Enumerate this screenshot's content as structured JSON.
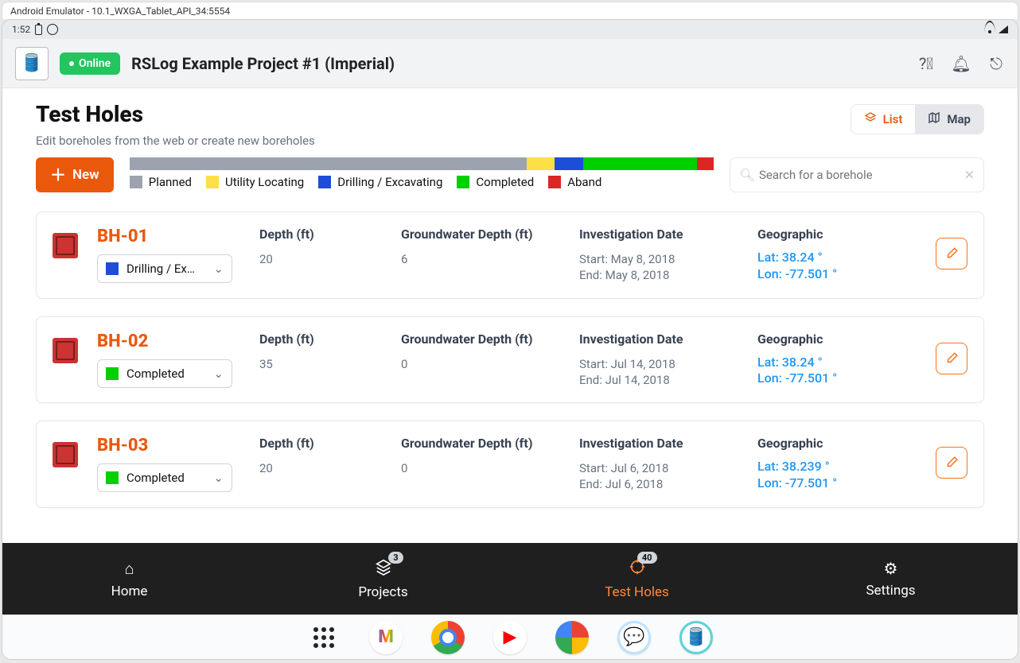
{
  "emulator_title": "Android Emulator - 10.1_WXGA_Tablet_API_34:5554",
  "status": {
    "time": "1:52"
  },
  "header": {
    "online": "Online",
    "project": "RSLog Example Project #1 (Imperial)"
  },
  "page": {
    "title": "Test Holes",
    "subtitle": "Edit boreholes from the web or create new boreholes",
    "new_label": "New",
    "view": {
      "list": "List",
      "map": "Map"
    },
    "search_placeholder": "Search for a borehole"
  },
  "legend": {
    "items": [
      {
        "label": "Planned",
        "color": "#9ca3af",
        "weight": 14
      },
      {
        "label": "Utility Locating",
        "color": "#fde047",
        "weight": 1
      },
      {
        "label": "Drilling / Excavating",
        "color": "#1d4ed8",
        "weight": 1
      },
      {
        "label": "Completed",
        "color": "#00d000",
        "weight": 4
      },
      {
        "label": "Aband",
        "color": "#dc2626",
        "weight": 0.6
      }
    ]
  },
  "columns": {
    "depth": "Depth (ft)",
    "gw": "Groundwater Depth (ft)",
    "date": "Investigation Date",
    "geo": "Geographic"
  },
  "boreholes": [
    {
      "name": "BH-01",
      "status_label": "Drilling / Ex…",
      "status_color": "#1d4ed8",
      "depth": "20",
      "gw": "6",
      "start": "Start: May 8, 2018",
      "end": "End: May 8, 2018",
      "lat": "Lat: 38.24 °",
      "lon": "Lon: -77.501 °"
    },
    {
      "name": "BH-02",
      "status_label": "Completed",
      "status_color": "#00d000",
      "depth": "35",
      "gw": "0",
      "start": "Start: Jul 14, 2018",
      "end": "End: Jul 14, 2018",
      "lat": "Lat: 38.24 °",
      "lon": "Lon: -77.501 °"
    },
    {
      "name": "BH-03",
      "status_label": "Completed",
      "status_color": "#00d000",
      "depth": "20",
      "gw": "0",
      "start": "Start: Jul 6, 2018",
      "end": "End: Jul 6, 2018",
      "lat": "Lat: 38.239 °",
      "lon": "Lon: -77.501 °"
    }
  ],
  "nav": {
    "home": "Home",
    "projects": "Projects",
    "projects_badge": "3",
    "testholes": "Test Holes",
    "testholes_badge": "40",
    "settings": "Settings"
  }
}
